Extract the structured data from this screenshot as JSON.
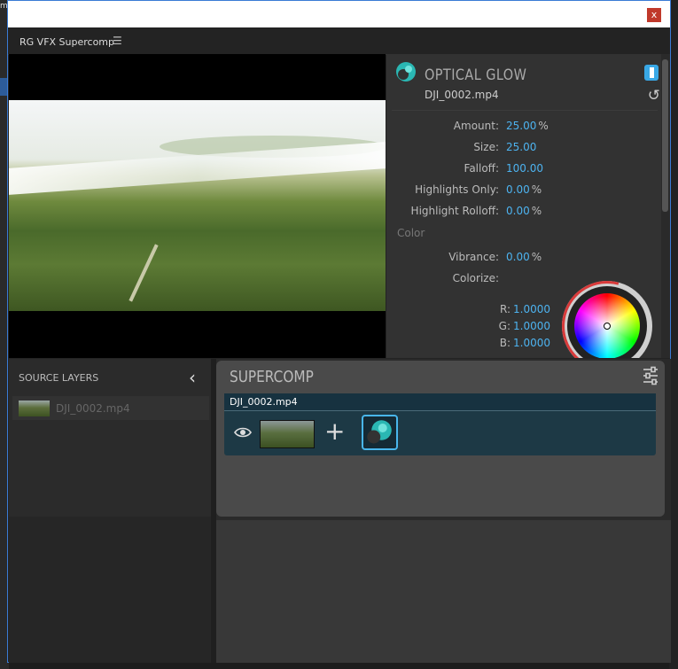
{
  "window": {
    "title": "",
    "close_glyph": "x"
  },
  "panel": {
    "title": "RG VFX Supercomp",
    "menu_glyph": "☰"
  },
  "effect": {
    "name": "OPTICAL GLOW",
    "file": "DJI_0002.mp4",
    "params": [
      {
        "label": "Amount:",
        "value": "25.00",
        "unit": "%"
      },
      {
        "label": "Size:",
        "value": "25.00",
        "unit": ""
      },
      {
        "label": "Falloff:",
        "value": "100.00",
        "unit": ""
      },
      {
        "label": "Highlights Only:",
        "value": "0.00",
        "unit": "%"
      },
      {
        "label": "Highlight Rolloff:",
        "value": "0.00",
        "unit": "%"
      }
    ],
    "color_section": "Color",
    "color_params": [
      {
        "label": "Vibrance:",
        "value": "0.00",
        "unit": "%"
      },
      {
        "label": "Colorize:",
        "value": "",
        "unit": ""
      }
    ],
    "rgb": [
      {
        "label": "R:",
        "value": "1.0000"
      },
      {
        "label": "G:",
        "value": "1.0000"
      },
      {
        "label": "B:",
        "value": "1.0000"
      }
    ],
    "reset_glyph": "↺"
  },
  "source_layers": {
    "title": "SOURCE LAYERS",
    "collapse_glyph": "‹",
    "items": [
      {
        "name": "DJI_0002.mp4"
      }
    ]
  },
  "supercomp": {
    "title": "SUPERCOMP",
    "layer_name": "DJI_0002.mp4",
    "plus_glyph": "+"
  },
  "colors": {
    "accent": "#4db3f0",
    "brand": "#2ab7b3",
    "layer_bg": "#1d3945"
  }
}
